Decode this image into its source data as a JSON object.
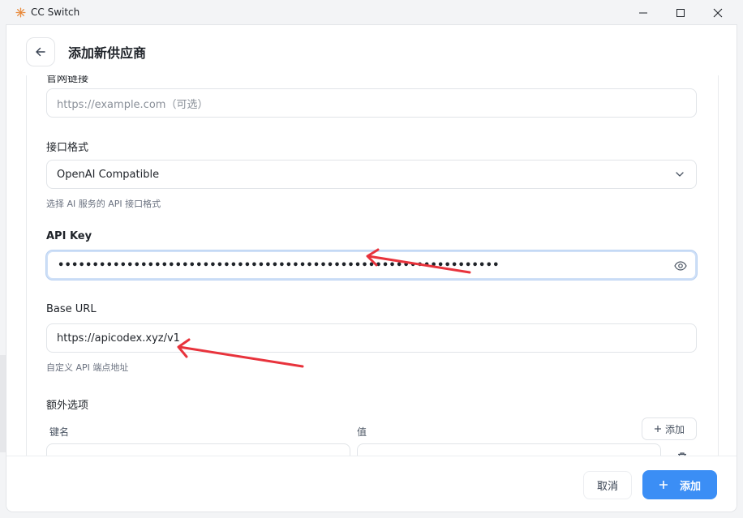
{
  "window": {
    "title": "CC Switch"
  },
  "dialog": {
    "title": "添加新供应商"
  },
  "fields": {
    "website": {
      "label": "官网链接",
      "placeholder": "https://example.com（可选）"
    },
    "api_format": {
      "label": "接口格式",
      "value": "OpenAI Compatible",
      "hint": "选择 AI 服务的 API 接口格式"
    },
    "api_key": {
      "label": "API Key",
      "masked_value": "••••••••••••••••••••••••••••••••••••••••••••••••••••••••••••••••"
    },
    "base_url": {
      "label": "Base URL",
      "value": "https://apicodex.xyz/v1",
      "hint": "自定义 API 端点地址"
    }
  },
  "extra_options": {
    "label": "额外选项",
    "add_label": "添加",
    "key_column": "键名",
    "value_column": "值"
  },
  "footer": {
    "cancel_label": "取消",
    "submit_label": "添加"
  },
  "colors": {
    "accent": "#3b8ef5",
    "annotation_arrow": "#e8333c"
  }
}
